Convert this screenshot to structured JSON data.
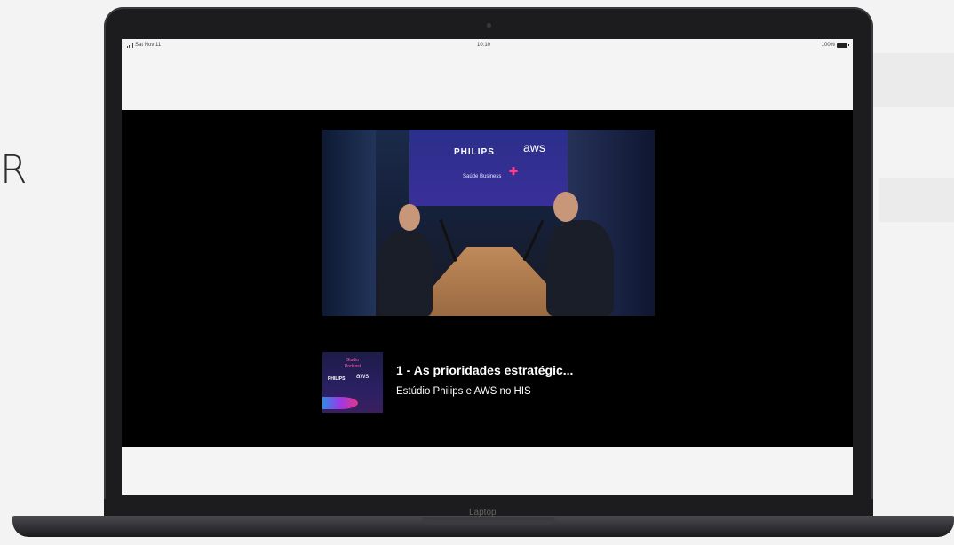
{
  "background": {
    "edge_letter": "R"
  },
  "status_bar": {
    "left_text": "Sat Nov 11",
    "time": "10:10",
    "battery": "100%"
  },
  "video": {
    "screen_brand": "PHILIPS",
    "screen_aws": "aws",
    "screen_sub": "Saúde Business"
  },
  "episode": {
    "title": "1 - As prioridades estratégic...",
    "subtitle": "Estúdio Philips e AWS no HIS",
    "art": {
      "line1": "Studio",
      "line2": "Podcast",
      "brand": "PHILIPS",
      "aws": "aws"
    }
  },
  "device": {
    "label": "Laptop"
  },
  "colors": {
    "player_bg": "#000000",
    "screen_bg": "#f4f4f4",
    "accent_pink": "#ff3d8b",
    "bezel": "#1c1c1e"
  }
}
